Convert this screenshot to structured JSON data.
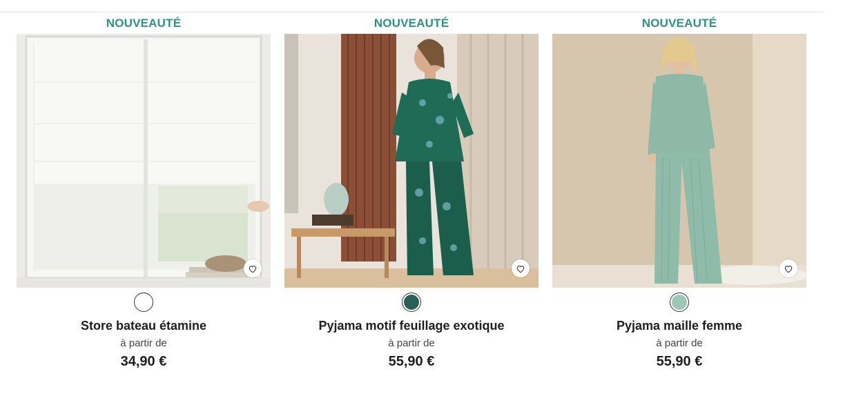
{
  "products": [
    {
      "badge": "NOUVEAUTÉ",
      "name": "Store bateau étamine",
      "from_label": "à partir de",
      "price": "34,90 €",
      "swatch_color": "#ffffff",
      "image_alt": "store-bateau-etamine-photo"
    },
    {
      "badge": "NOUVEAUTÉ",
      "name": "Pyjama motif feuillage exotique",
      "from_label": "à partir de",
      "price": "55,90 €",
      "swatch_color": "#2a5f57",
      "image_alt": "pyjama-motif-feuillage-photo"
    },
    {
      "badge": "NOUVEAUTÉ",
      "name": "Pyjama maille femme",
      "from_label": "à partir de",
      "price": "55,90 €",
      "swatch_color": "#9fc7b5",
      "image_alt": "pyjama-maille-photo"
    }
  ],
  "colors": {
    "badge": "#2f8f84",
    "text": "#1f1f1f"
  },
  "icons": {
    "wishlist": "heart-icon"
  }
}
